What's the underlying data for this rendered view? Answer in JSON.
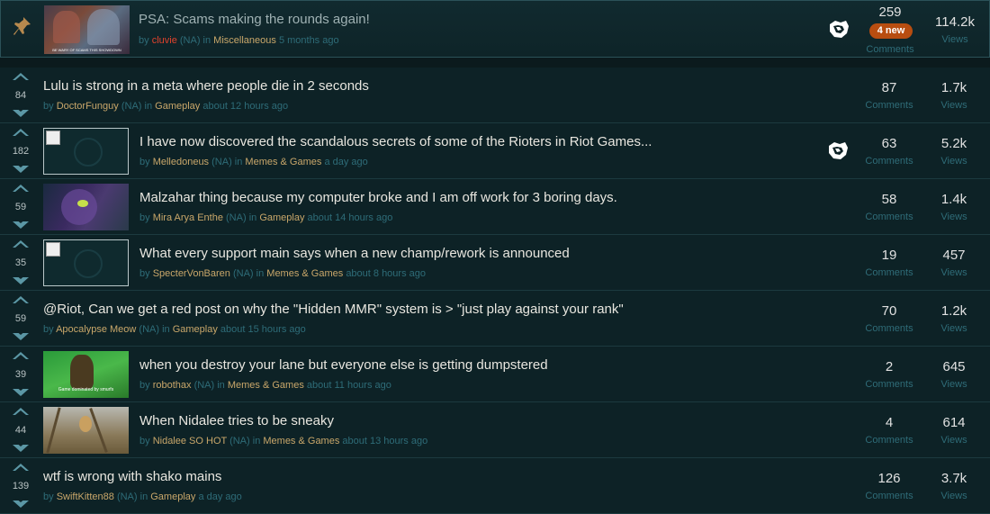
{
  "labels": {
    "comments": "Comments",
    "views": "Views",
    "by": "by",
    "in": "in"
  },
  "pinned": {
    "title": "PSA: Scams making the rounds again!",
    "author": "cluvie",
    "region": "(NA)",
    "category": "Miscellaneous",
    "time": "5 months ago",
    "comments": "259",
    "badge": "4 new",
    "views": "114.2k",
    "thumb_caption": "BE WARY OF SCAMS THIS SHOWDOWN"
  },
  "posts": [
    {
      "score": "84",
      "title": "Lulu is strong in a meta where people die in 2 seconds",
      "author": "DoctorFunguy",
      "region": "(NA)",
      "category": "Gameplay",
      "time": "about 12 hours ago",
      "comments": "87",
      "views": "1.7k"
    },
    {
      "score": "182",
      "title": "I have now discovered the scandalous secrets of some of the Rioters in Riot Games...",
      "author": "Melledoneus",
      "region": "(NA)",
      "category": "Memes & Games",
      "time": "a day ago",
      "comments": "63",
      "views": "5.2k"
    },
    {
      "score": "59",
      "title": "Malzahar thing because my computer broke and I am off work for 3 boring days.",
      "author": "Mira Arya Enthe",
      "region": "(NA)",
      "category": "Gameplay",
      "time": "about 14 hours ago",
      "comments": "58",
      "views": "1.4k"
    },
    {
      "score": "35",
      "title": "What every support main says when a new champ/rework is announced",
      "author": "SpecterVonBaren",
      "region": "(NA)",
      "category": "Memes & Games",
      "time": "about 8 hours ago",
      "comments": "19",
      "views": "457"
    },
    {
      "score": "59",
      "title": "@Riot, Can we get a red post on why the \"Hidden MMR\" system is > \"just play against your rank\"",
      "author": "Apocalypse Meow",
      "region": "(NA)",
      "category": "Gameplay",
      "time": "about 15 hours ago",
      "comments": "70",
      "views": "1.2k"
    },
    {
      "score": "39",
      "title": "when you destroy your lane but everyone else is getting dumpstered",
      "author": "robothax",
      "region": "(NA)",
      "category": "Memes & Games",
      "time": "about 11 hours ago",
      "comments": "2",
      "views": "645",
      "thumb_caption": "Game dominated by smurfs"
    },
    {
      "score": "44",
      "title": "When Nidalee tries to be sneaky",
      "author": "Nidalee SO HOT",
      "region": "(NA)",
      "category": "Memes & Games",
      "time": "about 13 hours ago",
      "comments": "4",
      "views": "614"
    },
    {
      "score": "139",
      "title": "wtf is wrong with shako mains",
      "author": "SwiftKitten88",
      "region": "(NA)",
      "category": "Gameplay",
      "time": "a day ago",
      "comments": "126",
      "views": "3.7k"
    }
  ],
  "icons": {
    "pin": "pin-icon",
    "riot": "riot-fist-icon",
    "up": "upvote-arrow-icon",
    "down": "downvote-arrow-icon"
  }
}
